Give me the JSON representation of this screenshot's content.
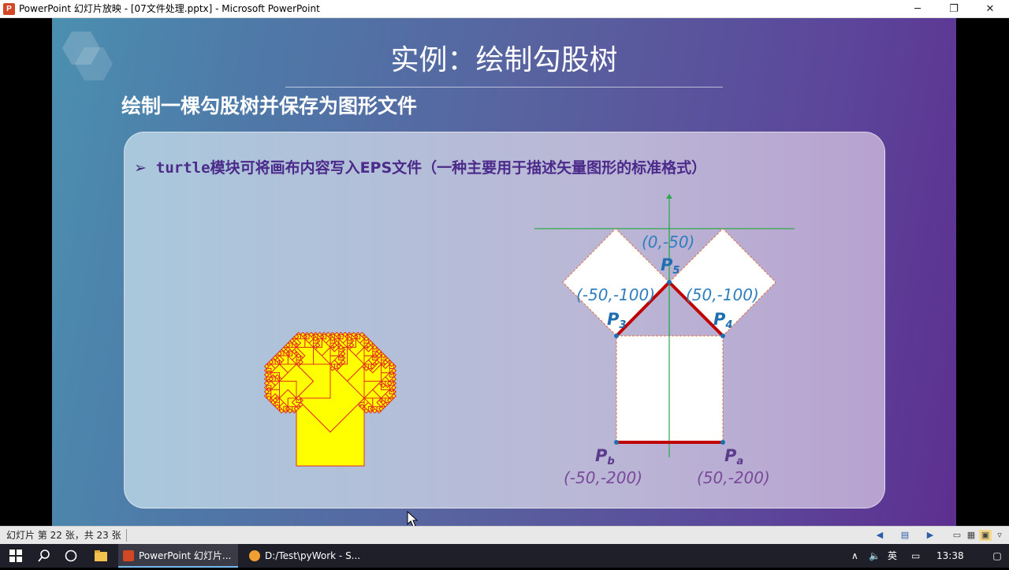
{
  "window": {
    "title": "PowerPoint 幻灯片放映 - [07文件处理.pptx] - Microsoft PowerPoint",
    "app_icon": "P",
    "minimize": "─",
    "maximize": "❐",
    "close": "✕"
  },
  "slide": {
    "title": "实例：绘制勾股树",
    "subtitle": "绘制一棵勾股树并保存为图形文件",
    "bullet_arrow": "➢",
    "bullet_mono": "turtle",
    "bullet_text": "模块可将画布内容写入EPS文件（一种主要用于描述矢量图形的标准格式）",
    "diagram": {
      "origin_label": "(0,-50)",
      "left_label": "(-50,-100)",
      "right_label": "(50,-100)",
      "pb_coord": "(-50,-200)",
      "pa_coord": "(50,-200)",
      "p5": {
        "base": "P",
        "sub": "5"
      },
      "p3": {
        "base": "P",
        "sub": "3"
      },
      "p4": {
        "base": "P",
        "sub": "4"
      },
      "pb": {
        "base": "P",
        "sub": "b"
      },
      "pa": {
        "base": "P",
        "sub": "a"
      }
    },
    "colors": {
      "tree_fill": "#ffff00",
      "tree_stroke": "#e0301e",
      "axis": "#2ea84a",
      "edge_red": "#c00000"
    }
  },
  "status": {
    "slide_counter": "幻灯片 第 22 张，共 23 张"
  },
  "taskbar": {
    "apps": [
      {
        "label": "PowerPoint 幻灯片...",
        "active": true
      },
      {
        "label": "D:/Test\\pyWork - S...",
        "active": false
      }
    ],
    "ime": "英",
    "time": "13:38"
  }
}
